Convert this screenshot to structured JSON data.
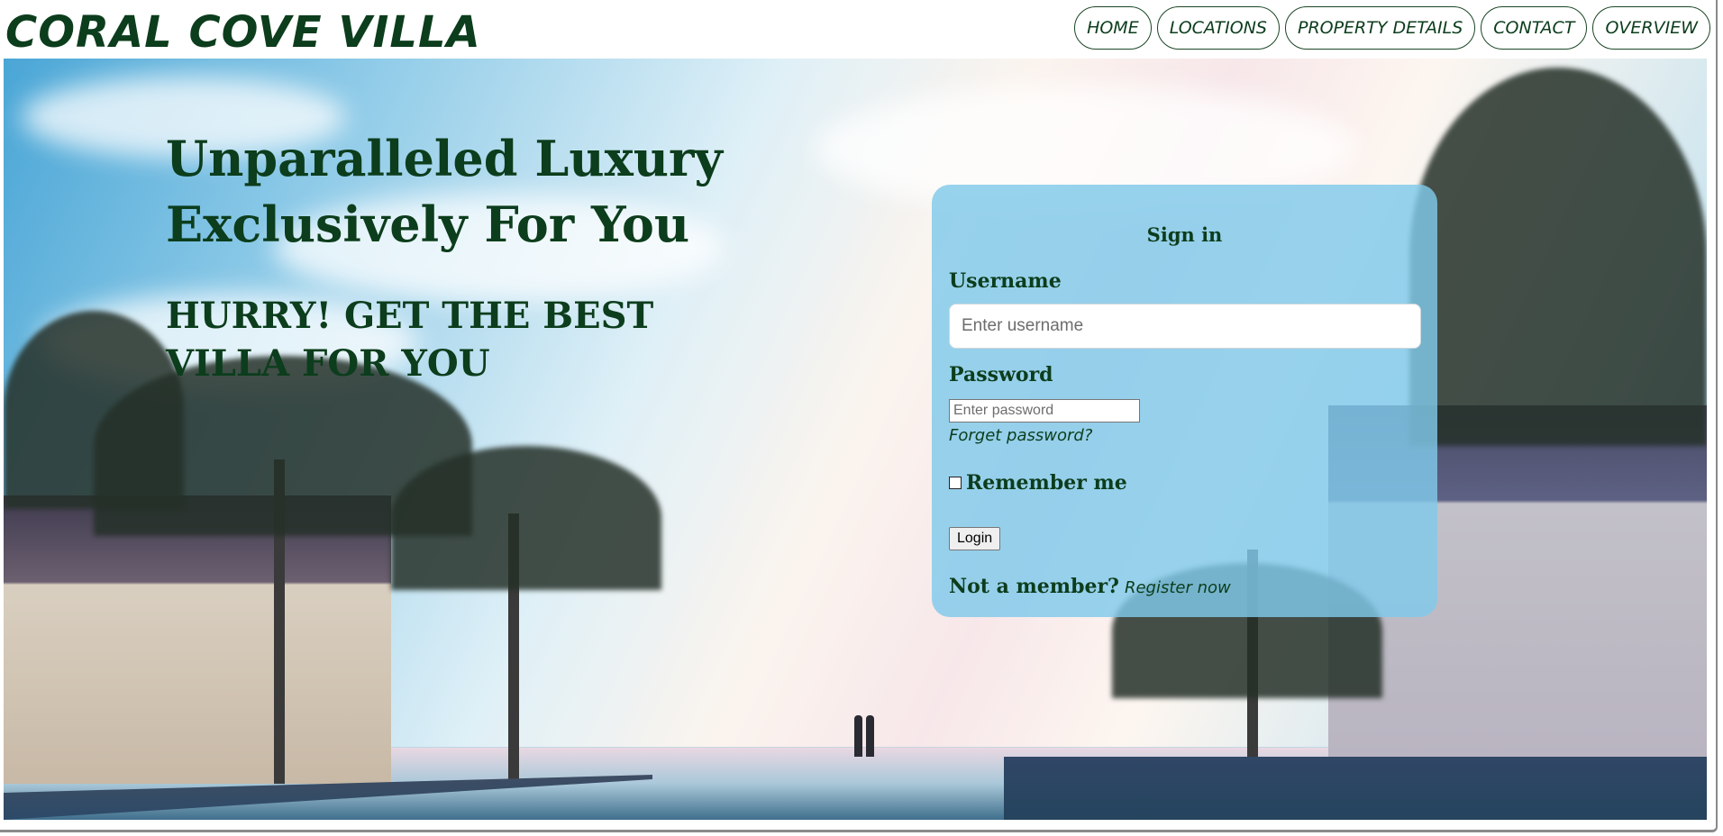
{
  "header": {
    "brand": "CORAL COVE VILLA",
    "nav": [
      {
        "label": "HOME"
      },
      {
        "label": "LOCATIONS"
      },
      {
        "label": "PROPERTY DETAILS"
      },
      {
        "label": "CONTACT"
      },
      {
        "label": "OVERVIEW"
      }
    ]
  },
  "hero": {
    "headline": "Unparalleled Luxury Exclusively For You",
    "subline": "HURRY! GET THE BEST VILLA FOR YOU"
  },
  "signin": {
    "title": "Sign in",
    "username_label": "Username",
    "username_placeholder": "Enter username",
    "username_value": "",
    "password_label": "Password",
    "password_placeholder": "Enter password",
    "password_value": "",
    "forget_link": "Forget password?",
    "remember_label": "Remember me",
    "remember_checked": false,
    "login_button": "Login",
    "member_question": "Not a member?",
    "register_link": "Register now"
  },
  "theme": {
    "text_color": "#0c3d1c",
    "card_color": "#80c9ea"
  }
}
